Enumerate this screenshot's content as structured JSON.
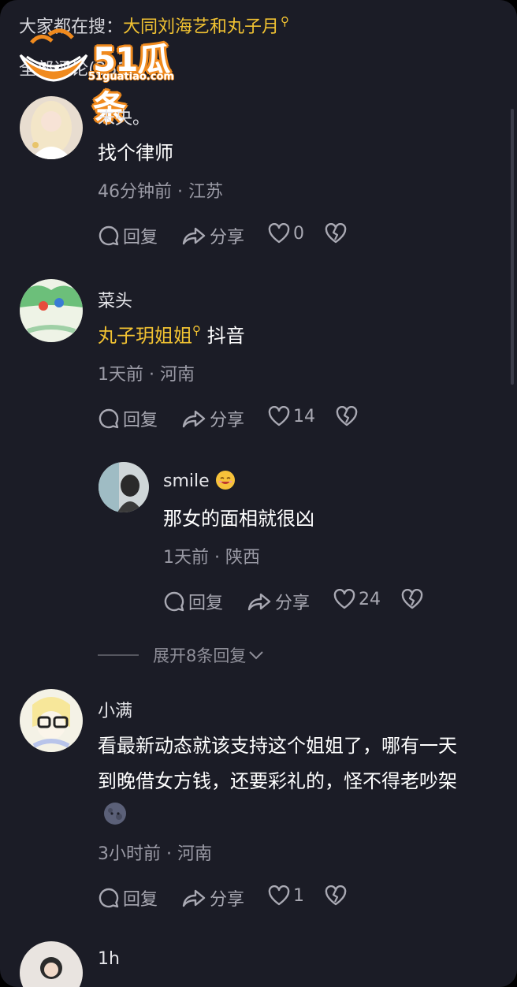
{
  "search": {
    "prefix": "大家都在搜：",
    "keyword": "大同刘海艺和丸子月"
  },
  "all_comments_label": "全部评论(351)",
  "watermark": {
    "brand": "51瓜条",
    "domain": "51guatiao.com"
  },
  "comments": [
    {
      "name": "未央。",
      "text": "找个律师",
      "meta": "46分钟前 · 江苏",
      "reply": "回复",
      "share": "分享",
      "likes": "0"
    },
    {
      "name": "菜头",
      "text_link": "丸子玥姐姐",
      "text_rest": "抖音",
      "meta": "1天前 · 河南",
      "reply": "回复",
      "share": "分享",
      "likes": "14"
    },
    {
      "name": "smile",
      "text": "那女的面相就很凶",
      "meta": "1天前 · 陕西",
      "reply": "回复",
      "share": "分享",
      "likes": "24"
    },
    {
      "name": "小满",
      "text_line1": "看最新动态就该支持这个姐姐了，哪有一天",
      "text_line2": "到晚借女方钱，还要彩礼的，怪不得老吵架",
      "meta": "3小时前 · 河南",
      "reply": "回复",
      "share": "分享",
      "likes": "1"
    },
    {
      "name": "1h"
    }
  ],
  "expand_replies": "展开8条回复",
  "colors": {
    "background": "#1b1c26",
    "highlight": "#f1c232",
    "meta": "#9a9aa5"
  }
}
